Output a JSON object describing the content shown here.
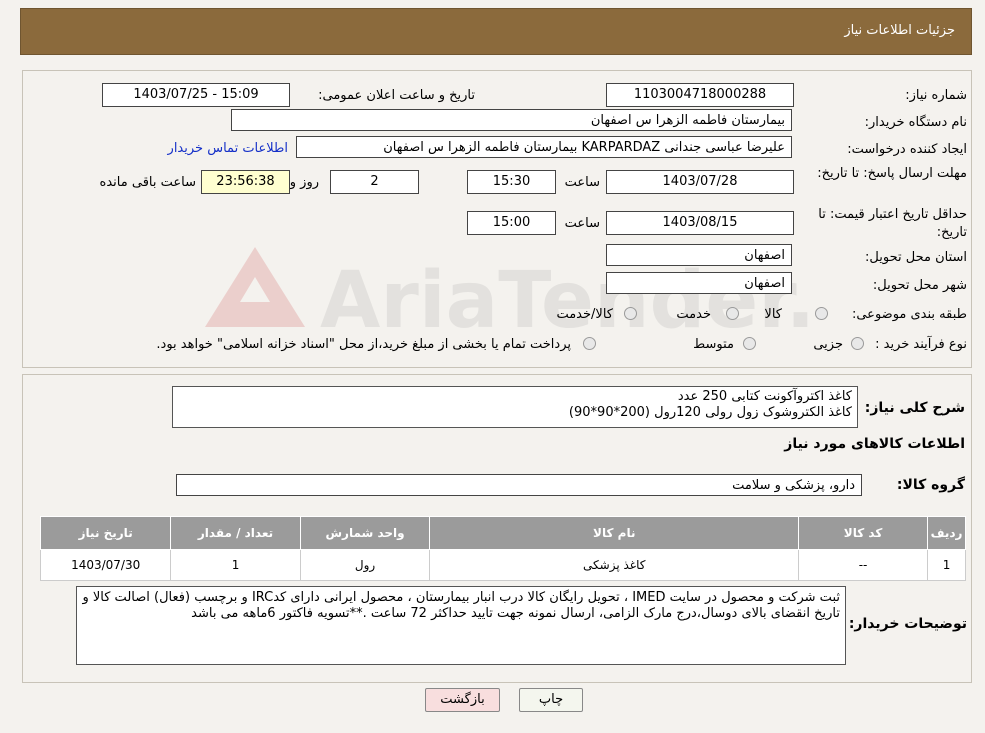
{
  "header": {
    "title": "جزئیات اطلاعات نیاز"
  },
  "form": {
    "need_number_label": "شماره نیاز:",
    "need_number": "1103004718000288",
    "announce_label": "تاریخ و ساعت اعلان عمومی:",
    "announce_value": "1403/07/25 - 15:09",
    "buyer_org_label": "نام دستگاه خریدار:",
    "buyer_org": "بیمارستان فاطمه الزهرا س  اصفهان",
    "creator_label": "ایجاد کننده درخواست:",
    "creator": "علیرضا عباسی جندانی KARPARDAZ بیمارستان فاطمه الزهرا س  اصفهان",
    "contact_link": "اطلاعات تماس خریدار",
    "deadline_label": "مهلت ارسال پاسخ: تا تاریخ:",
    "deadline_date": "1403/07/28",
    "time_label": "ساعت",
    "deadline_time": "15:30",
    "days_value": "2",
    "days_label": "روز و",
    "remaining_value": "23:56:38",
    "remaining_label": "ساعت باقی مانده",
    "validity_label": "حداقل تاریخ اعتبار قیمت: تا تاریخ:",
    "validity_date": "1403/08/15",
    "validity_time": "15:00",
    "province_label": "استان محل تحویل:",
    "province": "اصفهان",
    "city_label": "شهر محل تحویل:",
    "city": "اصفهان",
    "category_label": "طبقه بندی موضوعی:",
    "category_options": [
      "کالا",
      "خدمت",
      "کالا/خدمت"
    ],
    "process_label": "نوع فرآیند خرید :",
    "process_options": [
      "جزیی",
      "متوسط"
    ],
    "process_note": "پرداخت تمام یا بخشی از مبلغ خرید،از محل \"اسناد خزانه اسلامی\" خواهد بود."
  },
  "description": {
    "label": "شرح کلی نیاز:",
    "line1": "کاغذ اکتروآکونت  کتابی        250 عدد",
    "line2": "کاغذ الکتروشوک زول رولی     120رول  (200*90*90)"
  },
  "items_section": {
    "title": "اطلاعات کالاهای مورد نیاز",
    "group_label": "گروه کالا:",
    "group_value": "دارو، پزشکی و سلامت"
  },
  "table": {
    "headers": [
      "ردیف",
      "کد کالا",
      "نام کالا",
      "واحد شمارش",
      "تعداد / مقدار",
      "تاریخ نیاز"
    ],
    "rows": [
      [
        "1",
        "--",
        "کاغذ پزشکی",
        "رول",
        "1",
        "1403/07/30"
      ]
    ]
  },
  "buyer_notes": {
    "label": "توضیحات خریدار:",
    "text": "ثبت شرکت و محصول در سایت IMED ، تحویل رایگان کالا درب انبار بیمارستان ، محصول ایرانی دارای کدIRC و برچسب (فعال) اصالت کالا و تاریخ انقضای بالای دوسال،درج مارک الزامی،  ارسال نمونه جهت تایید حداکثر 72 ساعت .**تسویه فاکتور 6ماهه می باشد"
  },
  "buttons": {
    "print": "چاپ",
    "back": "بازگشت"
  },
  "watermark": {
    "text": "AriaTender.neT"
  },
  "colors": {
    "header_bg": "#8b6a3c",
    "table_header_bg": "#9b9b9b",
    "link": "#1530c8",
    "back_button_bg": "#f8dede"
  }
}
